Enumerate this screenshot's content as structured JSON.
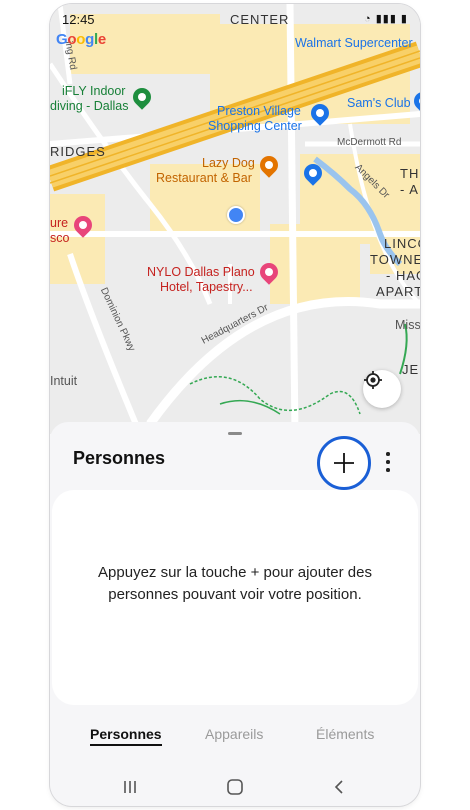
{
  "status_bar": {
    "time": "12:45",
    "icons": "wifi signal battery"
  },
  "map": {
    "logo": [
      "G",
      "o",
      "o",
      "g",
      "l",
      "e"
    ],
    "labels": {
      "center": "CENTER",
      "walmart": "Walmart Supercenter",
      "ifly_1": "iFLY Indoor",
      "ifly_2": "diving - Dallas",
      "preston_1": "Preston Village",
      "preston_2": "Shopping Center",
      "sams": "Sam's Club",
      "ridges": "RIDGES",
      "mcdermott": "McDermott Rd",
      "lazydog_1": "Lazy Dog",
      "lazydog_2": "Restaurant & Bar",
      "th": "TH",
      "a": "- A",
      "angels": "Angels Dr",
      "ure": "ure",
      "sco": "sco",
      "linco": "LINCO",
      "towne": "TOWNE",
      "hag": "- HAG",
      "apart": "APART",
      "nylo_1": "NYLO Dallas Plano",
      "nylo_2": "Hotel, Tapestry...",
      "dominion": "Dominion Pkwy",
      "headquarters": "Headquarters Dr",
      "miss": "Miss",
      "je": "JE",
      "intuit": "Intuit",
      "ing_rd": "ing Rd"
    },
    "colors": {
      "road_major": "#f4c542",
      "area_yellow": "#fbeab4",
      "water": "#9ac4ee",
      "green": "#34a853"
    }
  },
  "sheet": {
    "title": "Personnes",
    "add_icon": "plus-icon",
    "empty_message": "Appuyez sur la touche + pour ajouter des personnes pouvant voir votre position."
  },
  "tabs": [
    {
      "label": "Personnes",
      "active": true
    },
    {
      "label": "Appareils",
      "active": false
    },
    {
      "label": "Éléments",
      "active": false
    }
  ],
  "nav_bar": {
    "recents": "recents-icon",
    "home": "home-icon",
    "back": "back-icon"
  },
  "accent_color": "#1a5fd6"
}
